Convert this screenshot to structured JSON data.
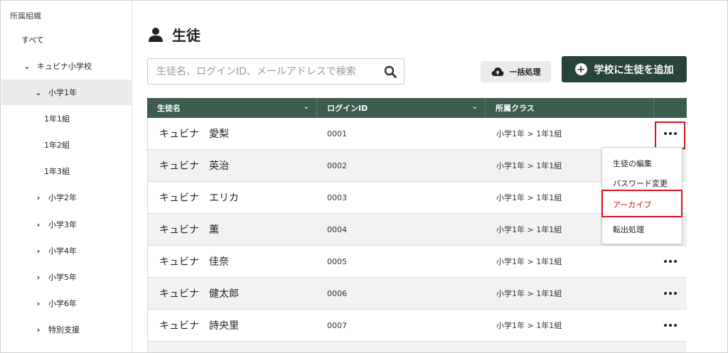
{
  "sidebar": {
    "header": "所属組織",
    "items": [
      {
        "label": "すべて",
        "chevron": ""
      },
      {
        "label": "キュビナ小学校",
        "chevron": "down"
      },
      {
        "label": "小学1年",
        "chevron": "down"
      },
      {
        "label": "1年1組",
        "chevron": ""
      },
      {
        "label": "1年2組",
        "chevron": ""
      },
      {
        "label": "1年3組",
        "chevron": ""
      },
      {
        "label": "小学2年",
        "chevron": "right"
      },
      {
        "label": "小学3年",
        "chevron": "right"
      },
      {
        "label": "小学4年",
        "chevron": "right"
      },
      {
        "label": "小学5年",
        "chevron": "right"
      },
      {
        "label": "小学6年",
        "chevron": "right"
      },
      {
        "label": "特別支援",
        "chevron": "right"
      }
    ]
  },
  "page": {
    "title": "生徒"
  },
  "search": {
    "placeholder": "生徒名、ログインID、メールアドレスで検索",
    "value": ""
  },
  "toolbar": {
    "bulk_label": "一括処理",
    "add_label": "学校に生徒を追加"
  },
  "table": {
    "columns": [
      "生徒名",
      "ログインID",
      "所属クラス"
    ],
    "rows": [
      {
        "name": "キュビナ　愛梨",
        "id": "0001",
        "class": "小学1年 > 1年1組"
      },
      {
        "name": "キュビナ　英治",
        "id": "0002",
        "class": "小学1年 > 1年1組"
      },
      {
        "name": "キュビナ　エリカ",
        "id": "0003",
        "class": "小学1年 > 1年1組"
      },
      {
        "name": "キュビナ　薫",
        "id": "0004",
        "class": "小学1年 > 1年1組"
      },
      {
        "name": "キュビナ　佳奈",
        "id": "0005",
        "class": "小学1年 > 1年1組"
      },
      {
        "name": "キュビナ　健太郎",
        "id": "0006",
        "class": "小学1年 > 1年1組"
      },
      {
        "name": "キュビナ　詩央里",
        "id": "0007",
        "class": "小学1年 > 1年1組"
      }
    ]
  },
  "menu": {
    "items": [
      "生徒の編集",
      "パスワード変更",
      "アーカイブ",
      "転出処理"
    ]
  },
  "colors": {
    "primary": "#27433a",
    "table_header": "#3d5c4e",
    "highlight": "#e0101a",
    "danger_text": "#d0101a"
  }
}
